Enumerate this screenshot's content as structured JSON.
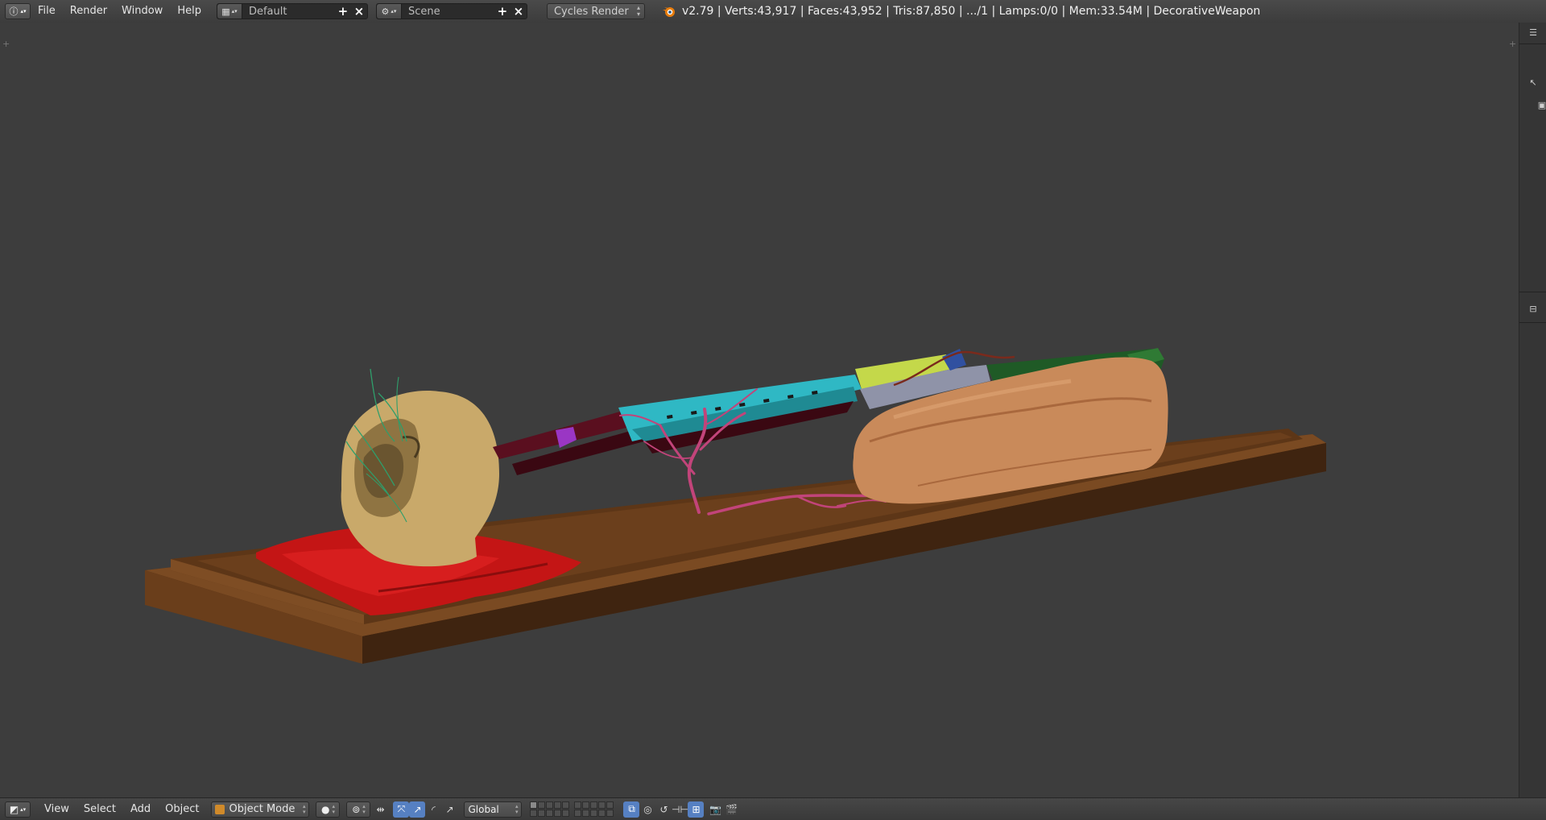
{
  "header": {
    "editor_icon": "info-icon",
    "menus": [
      "File",
      "Render",
      "Window",
      "Help"
    ],
    "screen_layout": "Default",
    "scene": "Scene",
    "render_engine": "Cycles Render",
    "stats": "v2.79 | Verts:43,917 | Faces:43,952 | Tris:87,850 | .../1 | Lamps:0/0 | Mem:33.54M | DecorativeWeapon"
  },
  "viewport_header": {
    "menus": [
      "View",
      "Select",
      "Add",
      "Object"
    ],
    "mode": "Object Mode",
    "transform_orientation": "Global"
  },
  "colors": {
    "viewport_bg": "#3d3d3d",
    "header_bg": "#424242",
    "selection_blue": "#5680c2",
    "pedestal": "#6b3f1c",
    "pillow": "#c41515",
    "skull": "#c9a96a",
    "shotgun_barrel_cyan": "#2fb8c4",
    "shotgun_dark_red": "#4a0a18",
    "branches": "#c2447a",
    "flesh_block": "#c98a5a",
    "bottle_green": "#1f5a26"
  },
  "icons": {
    "add": "plus-icon",
    "close": "close-icon",
    "blender": "blender-logo-icon",
    "outliner": "outliner-icon",
    "properties": "properties-icon"
  }
}
